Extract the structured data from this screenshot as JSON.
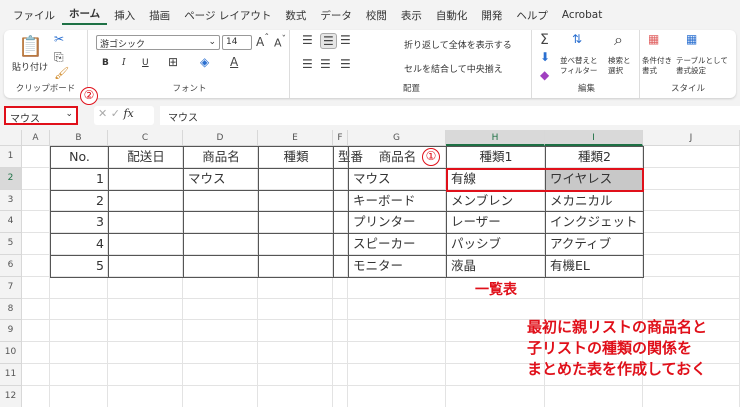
{
  "tabs": [
    "ファイル",
    "ホーム",
    "挿入",
    "描画",
    "ページ レイアウト",
    "数式",
    "データ",
    "校閲",
    "表示",
    "自動化",
    "開発",
    "ヘルプ",
    "Acrobat"
  ],
  "ribbon": {
    "clipboard": {
      "paste": "貼り付け",
      "label": "クリップボード"
    },
    "font": {
      "name": "游ゴシック",
      "size": "14",
      "bold": "B",
      "italic": "I",
      "underline": "U",
      "label": "フォント"
    },
    "alignment": {
      "wrap": "折り返して全体を表示する",
      "merge": "セルを結合して中央揃え",
      "label": "配置"
    },
    "editing": {
      "sort_line1": "並べ替えと",
      "sort_line2": "フィルター",
      "find_line1": "検索と",
      "find_line2": "選択",
      "label": "編集"
    },
    "styles": {
      "cond_line1": "条件付き",
      "cond_line2": "書式",
      "table_line1": "テーブルとして",
      "table_line2": "書式設定",
      "label": "スタイル"
    }
  },
  "formula_bar": {
    "name_box": "マウス",
    "fx": "fx",
    "formula": "マウス"
  },
  "columns": [
    "A",
    "B",
    "C",
    "D",
    "E",
    "F",
    "G",
    "H",
    "I",
    "J"
  ],
  "rows": [
    "1",
    "2",
    "3",
    "4",
    "5",
    "6",
    "7",
    "8",
    "9",
    "10",
    "11",
    "12"
  ],
  "left_table": {
    "headers": [
      "No.",
      "配送日",
      "商品名",
      "種類",
      "型番"
    ],
    "rows": [
      [
        "1",
        "",
        "マウス",
        "",
        ""
      ],
      [
        "2",
        "",
        "",
        "",
        ""
      ],
      [
        "3",
        "",
        "",
        "",
        ""
      ],
      [
        "4",
        "",
        "",
        "",
        ""
      ],
      [
        "5",
        "",
        "",
        "",
        ""
      ]
    ]
  },
  "right_table": {
    "headers": [
      "商品名",
      "種類1",
      "種類2"
    ],
    "rows": [
      [
        "マウス",
        "有線",
        "ワイヤレス"
      ],
      [
        "キーボード",
        "メンブレン",
        "メカニカル"
      ],
      [
        "プリンター",
        "レーザー",
        "インクジェット"
      ],
      [
        "スピーカー",
        "パッシブ",
        "アクティブ"
      ],
      [
        "モニター",
        "液晶",
        "有機EL"
      ]
    ]
  },
  "annotations": {
    "step1": "①",
    "step2": "②",
    "table_caption": "一覧表",
    "note": [
      "最初に親リストの商品名と",
      "子リストの種類の関係を",
      "まとめた表を作成しておく"
    ]
  }
}
